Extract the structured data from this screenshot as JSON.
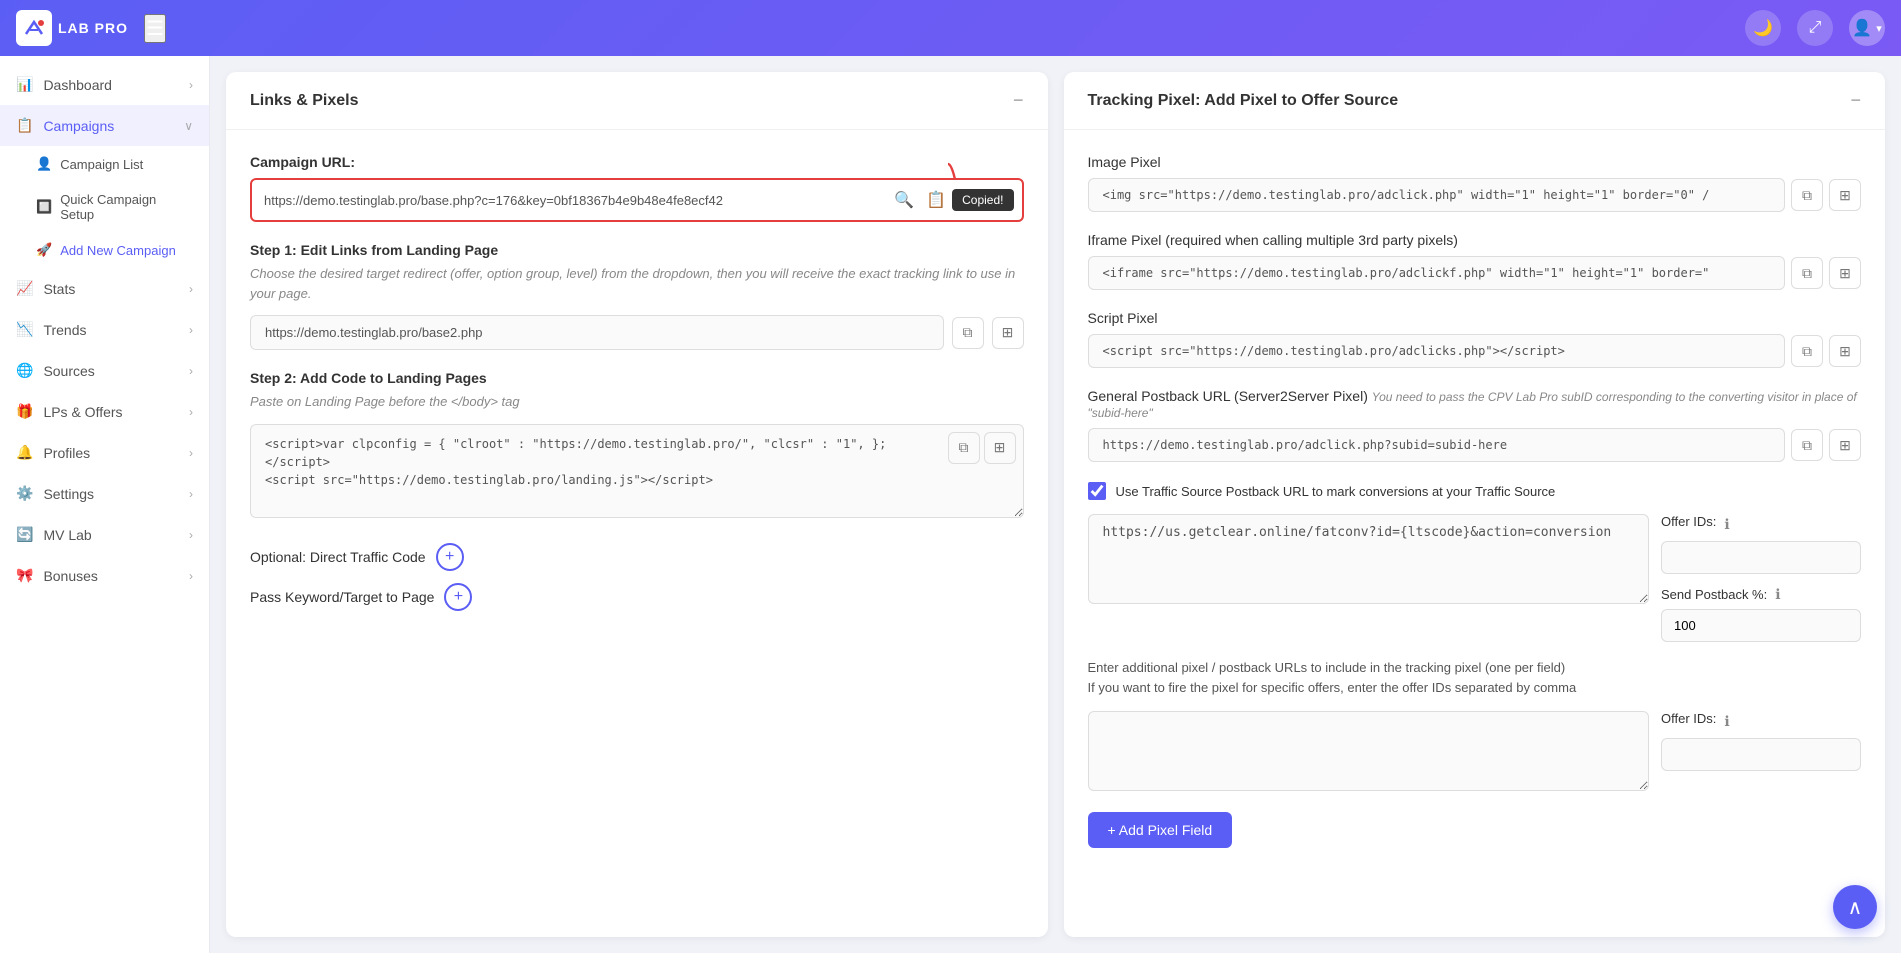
{
  "navbar": {
    "logo_text": "LAB PRO",
    "moon_icon": "🌙",
    "expand_icon": "⤢",
    "user_icon": "👤",
    "chevron_icon": "▾"
  },
  "sidebar": {
    "items": [
      {
        "id": "dashboard",
        "label": "Dashboard",
        "icon": "📊",
        "has_children": true
      },
      {
        "id": "campaigns",
        "label": "Campaigns",
        "icon": "📋",
        "has_children": true,
        "expanded": true
      },
      {
        "id": "campaign-list",
        "label": "Campaign List",
        "sub": true
      },
      {
        "id": "quick-campaign",
        "label": "Quick Campaign Setup",
        "sub": true
      },
      {
        "id": "add-campaign",
        "label": "Add New Campaign",
        "sub": true
      },
      {
        "id": "stats",
        "label": "Stats",
        "icon": "📈",
        "has_children": true
      },
      {
        "id": "trends",
        "label": "Trends",
        "icon": "📉",
        "has_children": true
      },
      {
        "id": "sources",
        "label": "Sources",
        "icon": "🌐",
        "has_children": true
      },
      {
        "id": "lps-offers",
        "label": "LPs & Offers",
        "icon": "🎁",
        "has_children": true
      },
      {
        "id": "profiles",
        "label": "Profiles",
        "icon": "🔔",
        "has_children": true
      },
      {
        "id": "settings",
        "label": "Settings",
        "icon": "⚙️",
        "has_children": true
      },
      {
        "id": "mv-lab",
        "label": "MV Lab",
        "icon": "🔄",
        "has_children": true
      },
      {
        "id": "bonuses",
        "label": "Bonuses",
        "icon": "🎀",
        "has_children": true
      }
    ]
  },
  "links_pixels": {
    "title": "Links & Pixels",
    "minimize_label": "−",
    "campaign_url_label": "Campaign URL:",
    "campaign_url_value": "https://demo.testinglab.pro/base.php?c=176&key=0bf18367b4e9b48e4fe8ecf42",
    "copied_badge": "Copied!",
    "step1_title": "Step 1: Edit Links from Landing Page",
    "step1_desc": "Choose the desired target redirect (offer, option group, level) from the dropdown, then you will receive the exact tracking link to use in your page.",
    "step1_url": "https://demo.testinglab.pro/base2.php",
    "step2_title": "Step 2: Add Code to Landing Pages",
    "step2_desc": "Paste on Landing Page before the </body> tag",
    "step2_code": "<script>var clpconfig = { \"clroot\" : \"https://demo.testinglab.pro/\", \"clcsr\" : \"1\", };\n</script>\n<script src=\"https://demo.testinglab.pro/landing.js\"></script>",
    "optional_label": "Optional: Direct Traffic Code",
    "pass_keyword_label": "Pass Keyword/Target to Page"
  },
  "tracking_pixel": {
    "title": "Tracking Pixel: Add Pixel to Offer Source",
    "minimize_label": "−",
    "image_pixel_label": "Image Pixel",
    "image_pixel_value": "<img src=\"https://demo.testinglab.pro/adclick.php\" width=\"1\" height=\"1\" border=\"0\" /",
    "iframe_pixel_label": "Iframe Pixel (required when calling multiple 3rd party pixels)",
    "iframe_pixel_value": "<iframe src=\"https://demo.testinglab.pro/adclickf.php\" width=\"1\" height=\"1\" border=\"",
    "script_pixel_label": "Script Pixel",
    "script_pixel_value": "<script src=\"https://demo.testinglab.pro/adclicks.php\"></script>",
    "general_postback_label": "General Postback URL (Server2Server Pixel)",
    "general_postback_note": "You need to pass the CPV Lab Pro subID corresponding to the converting visitor in place of \"subid-here\"",
    "general_postback_value": "https://demo.testinglab.pro/adclick.php?subid=subid-here",
    "checkbox_label": "Use Traffic Source Postback URL to mark conversions at your Traffic Source",
    "postback_url_value": "https://us.getclear.online/fatconv?id={ltscode}&action=conversion",
    "offer_ids_label": "Offer IDs:",
    "offer_ids_value": "",
    "send_postback_label": "Send Postback %:",
    "send_postback_value": "100",
    "desc_extra": "Enter additional pixel / postback URLs to include in the tracking pixel (one per field)\nIf you want to fire the pixel for specific offers, enter the offer IDs separated by comma",
    "offer_ids_label2": "Offer IDs:",
    "add_pixel_btn": "+ Add Pixel Field"
  }
}
